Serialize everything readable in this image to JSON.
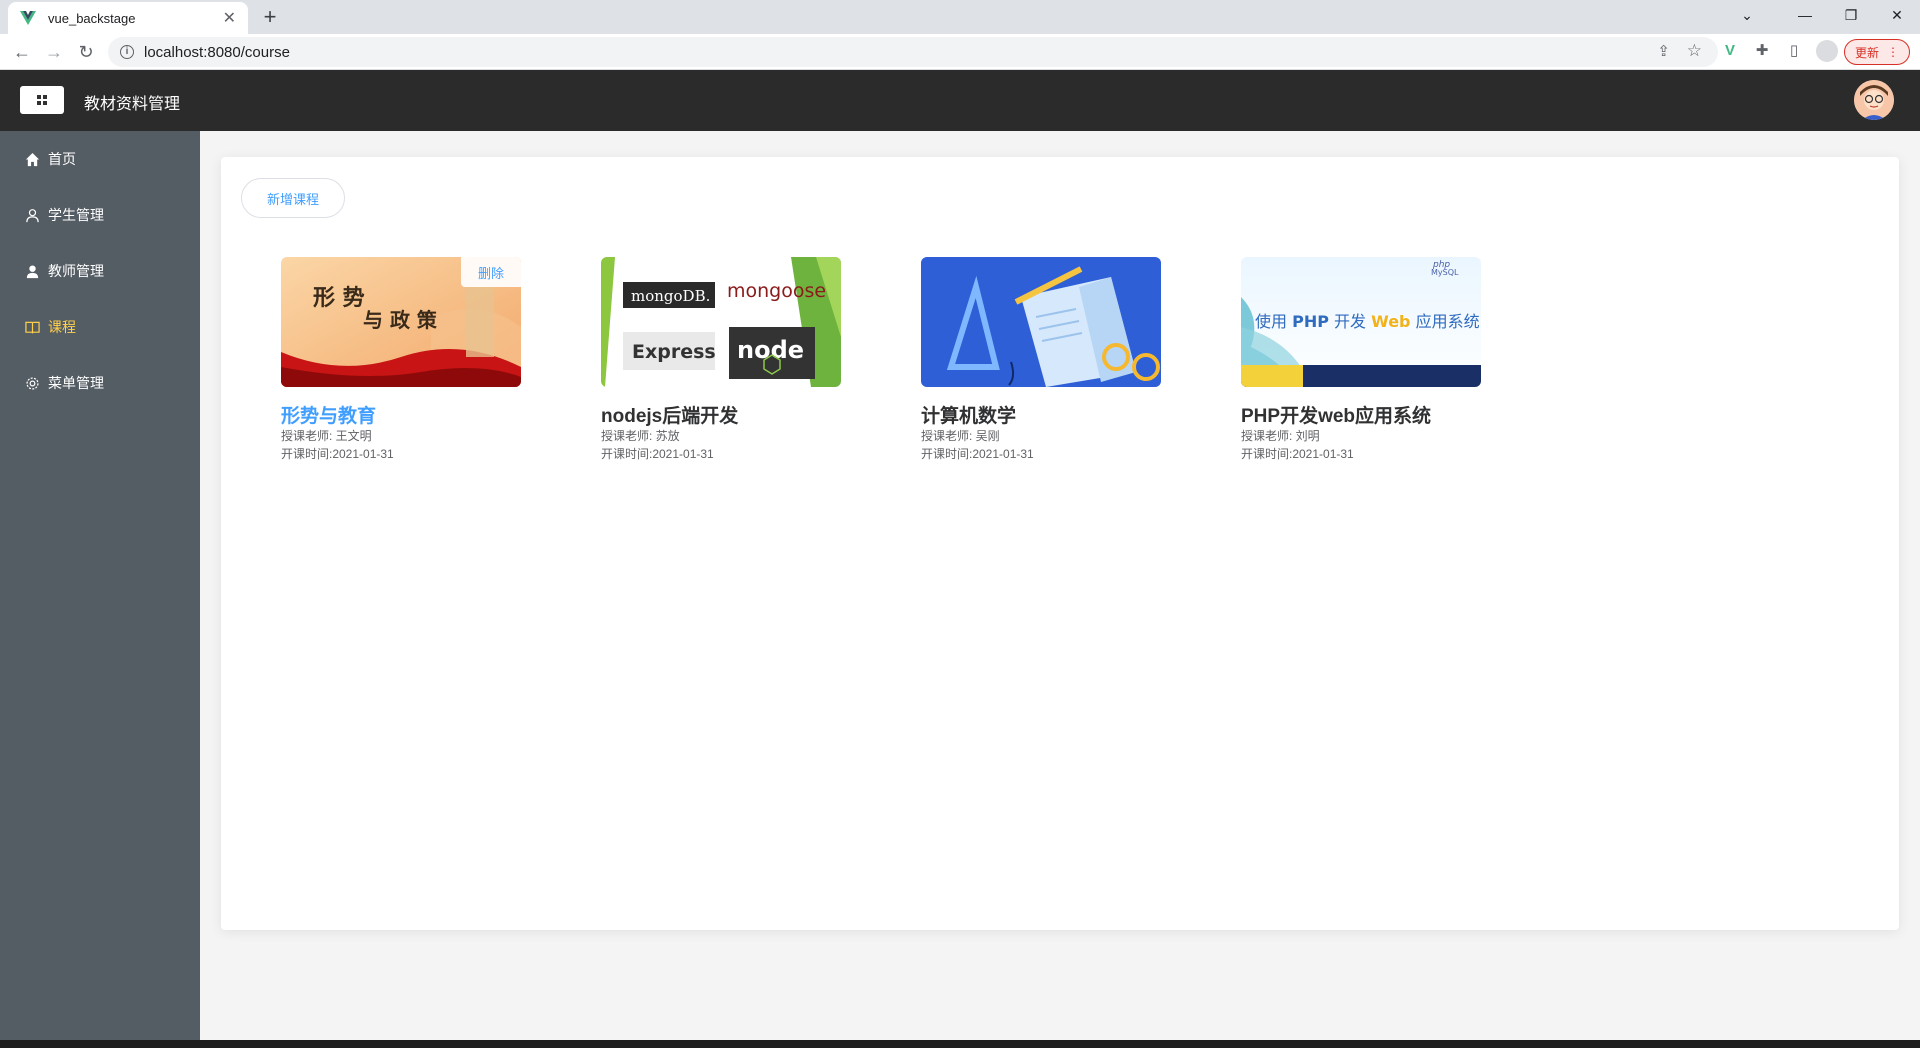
{
  "browser": {
    "tab_title": "vue_backstage",
    "url": "localhost:8080/course",
    "update_label": "更新"
  },
  "app": {
    "title": "教材资料管理"
  },
  "sidebar": {
    "items": [
      {
        "label": "首页",
        "icon": "home-icon",
        "active": false
      },
      {
        "label": "学生管理",
        "icon": "user-outline-icon",
        "active": false
      },
      {
        "label": "教师管理",
        "icon": "user-solid-icon",
        "active": false
      },
      {
        "label": "课程",
        "icon": "book-icon",
        "active": true
      },
      {
        "label": "菜单管理",
        "icon": "gear-icon",
        "active": false
      }
    ],
    "active_color": "#ffd04b"
  },
  "main": {
    "add_button_label": "新增课程",
    "delete_label": "删除",
    "courses": [
      {
        "name": "形势与教育",
        "teacher": "授课老师: 王文明",
        "date": "开课时间:2021-01-31",
        "cover_text": "形 势 与 政 策"
      },
      {
        "name": "nodejs后端开发",
        "teacher": "授课老师: 苏放",
        "date": "开课时间:2021-01-31",
        "cover_labels": [
          "mongoDB",
          "mongoose",
          "Express",
          "node"
        ]
      },
      {
        "name": "计算机数学",
        "teacher": "授课老师: 吴刚",
        "date": "开课时间:2021-01-31"
      },
      {
        "name": "PHP开发web应用系统",
        "teacher": "授课老师: 刘明",
        "date": "开课时间:2021-01-31",
        "cover_text": "使用 PHP 开发 Web 应用系统"
      }
    ]
  },
  "colors": {
    "header_bg": "#2b2b2b",
    "sidebar_bg": "#545c64",
    "accent": "#409eff"
  }
}
